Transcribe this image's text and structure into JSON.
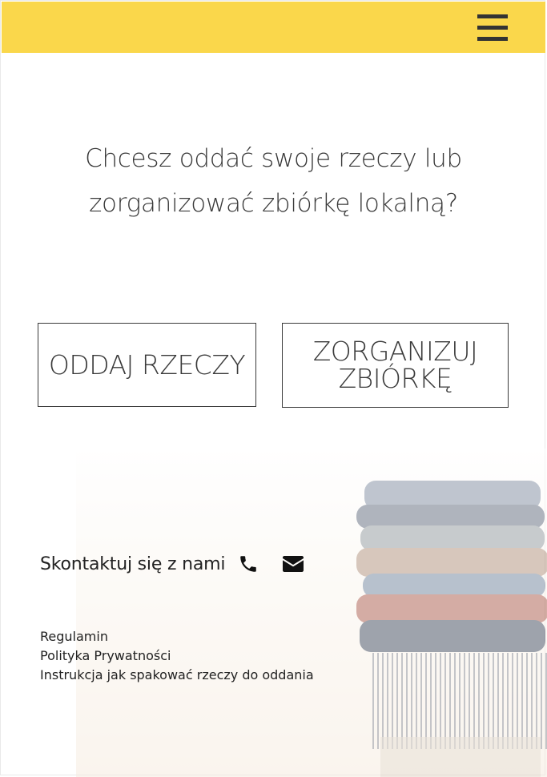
{
  "header": {
    "menu_icon": "hamburger-menu-icon",
    "background_color": "#fad74b"
  },
  "hero": {
    "heading_line1": "Chcesz oddać swoje rzeczy lub",
    "heading_line2": "zorganizować zbiórkę lokalną?"
  },
  "actions": {
    "give_label": "ODDAJ RZECZY",
    "organize_label_line1": "ZORGANIZUJ",
    "organize_label_line2": "ZBIÓRKĘ"
  },
  "contact": {
    "label": "Skontaktuj się z nami",
    "phone_icon": "phone-icon",
    "mail_icon": "envelope-icon"
  },
  "footer": {
    "links": [
      "Regulamin",
      "Polityka Prywatności",
      "Instrukcja jak spakować rzeczy do oddania"
    ]
  }
}
